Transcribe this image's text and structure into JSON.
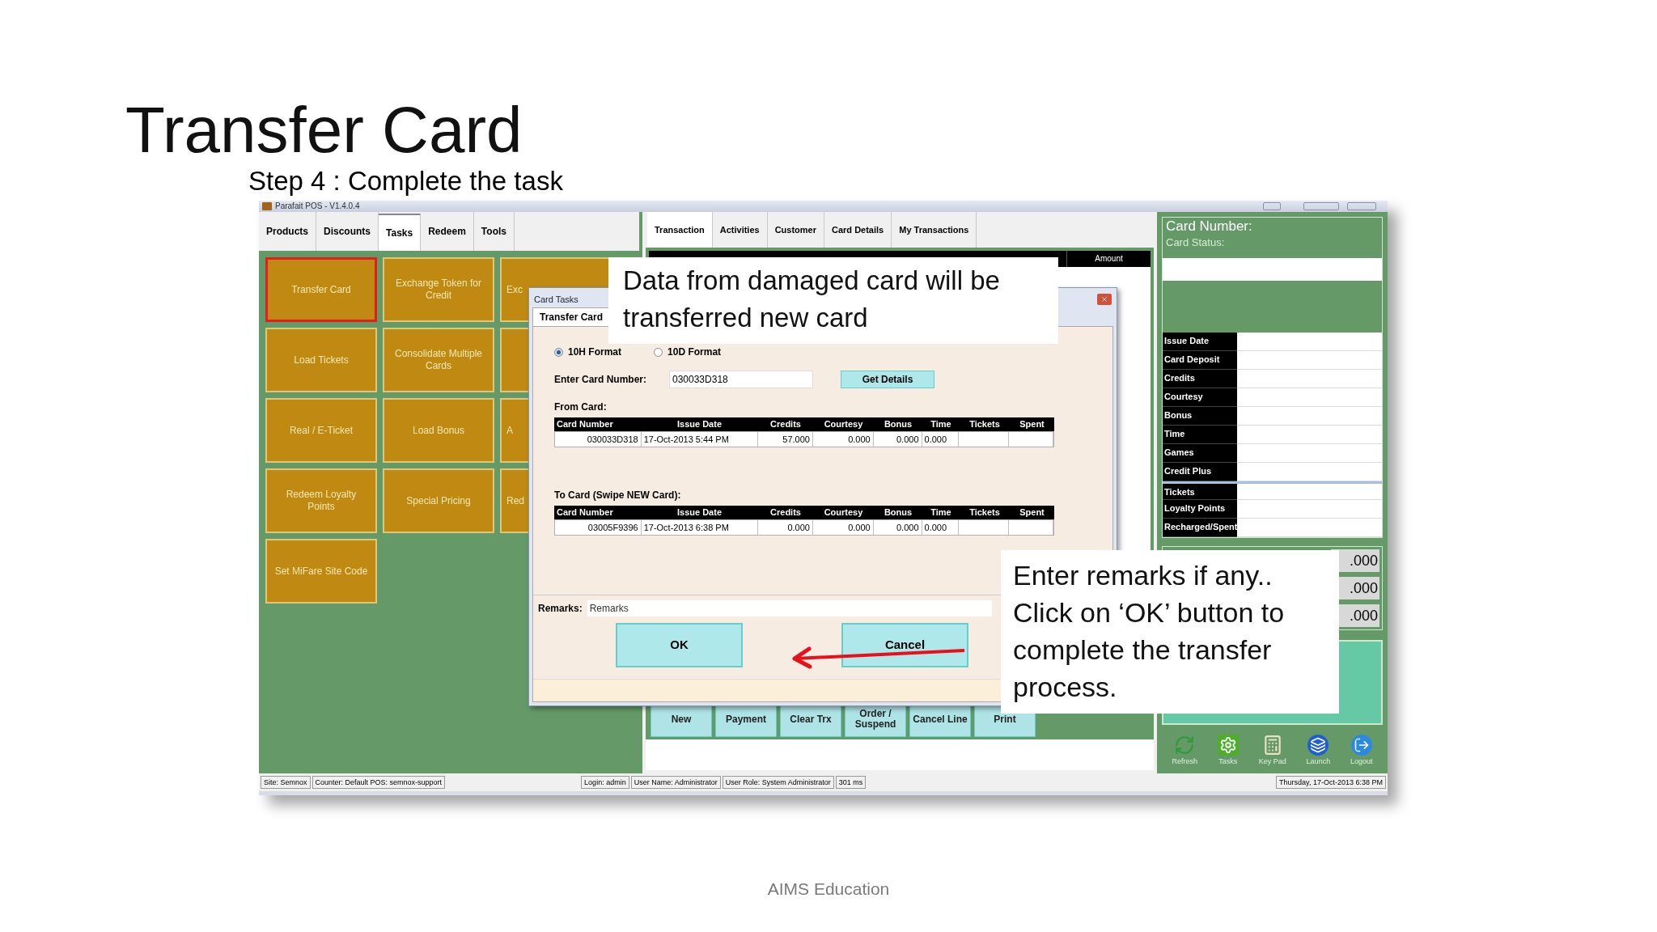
{
  "slide": {
    "title": "Transfer Card",
    "subtitle": "Step 4 : Complete the task",
    "footer": "AIMS Education"
  },
  "app": {
    "title": "Parafait POS - V1.4.0.4",
    "left_tabs": [
      {
        "label": "Products",
        "selected": false
      },
      {
        "label": "Discounts",
        "selected": false
      },
      {
        "label": "Tasks",
        "selected": true
      },
      {
        "label": "Redeem",
        "selected": false
      },
      {
        "label": "Tools",
        "selected": false
      }
    ],
    "tiles": [
      {
        "label": "Transfer Card",
        "selected": true
      },
      {
        "label": "Exchange Token for Credit",
        "selected": false
      },
      {
        "label": "Exc",
        "selected": false,
        "kind": "partial"
      },
      {
        "label": "Load Tickets",
        "selected": false
      },
      {
        "label": "Consolidate Multiple Cards",
        "selected": false
      },
      {
        "selected": false,
        "kind": "partial"
      },
      {
        "label": "Real / E-Ticket",
        "selected": false
      },
      {
        "label": "Load Bonus",
        "selected": false
      },
      {
        "label": "A",
        "selected": false,
        "kind": "partial"
      },
      {
        "label": "Redeem Loyalty Points",
        "selected": false
      },
      {
        "label": "Special Pricing",
        "selected": false
      },
      {
        "label": "Red",
        "selected": false,
        "kind": "partial"
      },
      {
        "label": "Set MiFare Site Code",
        "selected": false
      }
    ],
    "center_tabs": [
      {
        "label": "Transaction",
        "selected": true
      },
      {
        "label": "Activities",
        "selected": false
      },
      {
        "label": "Customer",
        "selected": false
      },
      {
        "label": "Card Details",
        "selected": false
      },
      {
        "label": "My Transactions",
        "selected": false
      }
    ],
    "grid_header": "Amount",
    "actions": [
      "New",
      "Payment",
      "Clear Trx",
      "Order / Suspend",
      "Cancel Line",
      "Print"
    ],
    "card_panel": {
      "card_number_label": "Card Number:",
      "card_status_label": "Card Status:",
      "fields": [
        "Issue Date",
        "Card Deposit",
        "Credits",
        "Courtesy",
        "Bonus",
        "Time",
        "Games",
        "Credit Plus",
        "Tickets",
        "Loyalty Points",
        "Recharged/Spent"
      ],
      "amounts": [
        ".000",
        ".000",
        ".000"
      ]
    },
    "toolbar": [
      {
        "label": "Refresh",
        "kind": "refresh"
      },
      {
        "label": "Tasks",
        "kind": "tasks"
      },
      {
        "label": "Key Pad",
        "kind": "keypad"
      },
      {
        "label": "Launch",
        "kind": "launch"
      },
      {
        "label": "Logout",
        "kind": "logout"
      }
    ],
    "status_bar": [
      "Site: Semnox",
      "Counter: Default POS: semnox-support",
      "Login: admin",
      "User Name: Administrator",
      "User Role: System Administrator",
      "301 ms",
      "Thursday, 17-Oct-2013 6:38 PM"
    ]
  },
  "dialog": {
    "title": "Card Tasks",
    "tab": "Transfer Card",
    "formats": [
      {
        "label": "10H Format",
        "selected": true
      },
      {
        "label": "10D Format",
        "selected": false
      }
    ],
    "card_number_label": "Enter Card Number:",
    "card_number": "030033D318",
    "get_details": "Get Details",
    "from_label": "From Card:",
    "to_label": "To Card (Swipe NEW Card):",
    "from_columns": [
      "Card Number",
      "Issue Date",
      "Credits",
      "Courtesy",
      "Bonus",
      "Time",
      "Tickets",
      "Spent"
    ],
    "to_columns": [
      "Card Number",
      "Issue Date",
      "Credits",
      "Courtesy",
      "Bonus",
      "Time",
      "Tickets",
      "Spent"
    ],
    "from_row": [
      "030033D318",
      "17-Oct-2013 5:44 PM",
      "57.000",
      "0.000",
      "0.000",
      "0.000"
    ],
    "to_row": [
      "03005F9396",
      "17-Oct-2013 6:38 PM",
      "0.000",
      "0.000",
      "0.000",
      "0.000"
    ],
    "remarks_label": "Remarks:",
    "remarks_placeholder": "Remarks",
    "buttons": [
      "OK",
      "Cancel"
    ]
  },
  "callouts": [
    "Data from damaged card will be transferred new card",
    "Enter remarks if any.. Click on ‘OK’ button to complete the transfer process."
  ]
}
